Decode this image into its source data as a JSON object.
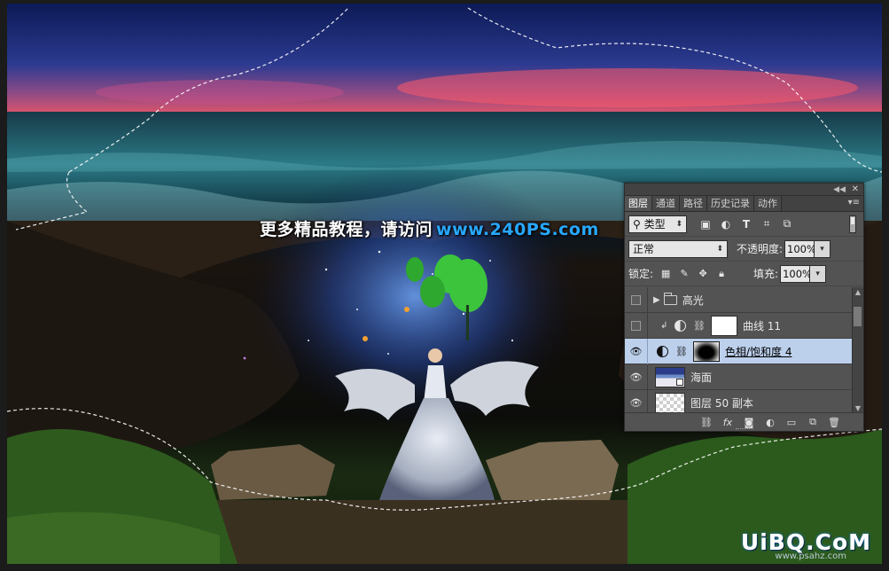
{
  "watermark": {
    "text": "更多精品教程，请访问",
    "site": "www.240PS.com"
  },
  "corner_logo": {
    "text": "UiBQ.CoM",
    "sub": "www.psahz.com"
  },
  "panel": {
    "tabs": [
      {
        "label": "图层",
        "active": true
      },
      {
        "label": "通道",
        "active": false
      },
      {
        "label": "路径",
        "active": false
      },
      {
        "label": "历史记录",
        "active": false
      },
      {
        "label": "动作",
        "active": false
      }
    ],
    "filter_kind": "类型",
    "blend_mode": "正常",
    "opacity_label": "不透明度:",
    "opacity_value": "100%",
    "lock_label": "锁定:",
    "fill_label": "填充:",
    "fill_value": "100%",
    "layers": [
      {
        "name": "高光",
        "type": "group",
        "visible": false,
        "selected": false
      },
      {
        "name": "曲线 11",
        "type": "curves",
        "visible": false,
        "selected": false,
        "clipped": true
      },
      {
        "name": "色相/饱和度 4",
        "type": "hue-saturation",
        "visible": true,
        "selected": true
      },
      {
        "name": "海面",
        "type": "smart-object",
        "visible": true,
        "selected": false
      },
      {
        "name": "图层 50 副本",
        "type": "pixel",
        "visible": true,
        "selected": false
      }
    ]
  },
  "colors": {
    "selection": "#bcd0ec",
    "panel_bg": "#535353",
    "site_blue": "#28a8ff"
  }
}
